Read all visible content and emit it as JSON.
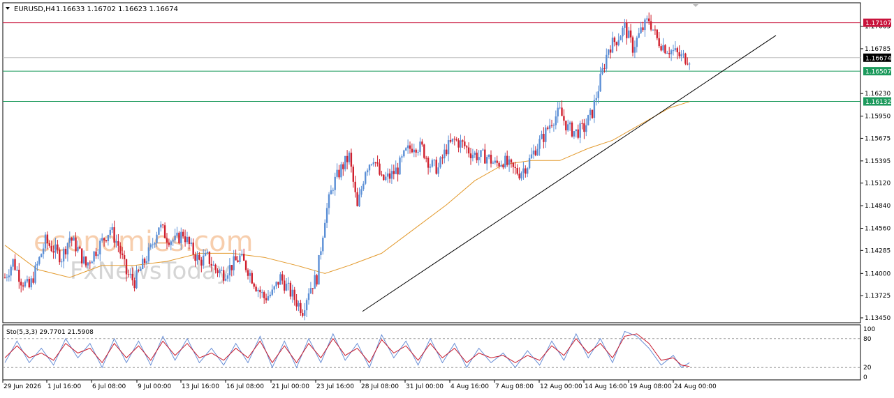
{
  "header": {
    "symbol": "EURUSD,H4",
    "ohlc": "1.16633 1.16702 1.16623 1.16674"
  },
  "watermark": {
    "line1": "economies.com",
    "line2": "FxNewsToday"
  },
  "chart_data": {
    "type": "candlestick",
    "symbol": "EURUSD",
    "timeframe": "H4",
    "ylim": [
      1.1345,
      1.1732
    ],
    "price_ticks": [
      "1.17065",
      "1.16785",
      "1.16230",
      "1.15950",
      "1.15675",
      "1.15395",
      "1.15120",
      "1.14840",
      "1.14560",
      "1.14285",
      "1.14000",
      "1.13725",
      "1.13450"
    ],
    "horizontal_levels": [
      {
        "value": 1.17107,
        "label": "1.17107",
        "color": "#c8143c",
        "kind": "resistance"
      },
      {
        "value": 1.16674,
        "label": "1.16674",
        "color": "#000000",
        "kind": "current-price"
      },
      {
        "value": 1.16507,
        "label": "1.16507",
        "color": "#1c9a5c",
        "kind": "support"
      },
      {
        "value": 1.16132,
        "label": "1.16132",
        "color": "#1c9a5c",
        "kind": "support"
      }
    ],
    "trendline": {
      "from": [
        0,
        1.1353
      ],
      "to": [
        145,
        1.1695
      ]
    },
    "time_labels": [
      "29 Jun 2026",
      "1 Jul 16:00",
      "6 Jul 08:00",
      "9 Jul 00:00",
      "13 Jul 16:00",
      "16 Jul 08:00",
      "21 Jul 00:00",
      "23 Jul 16:00",
      "28 Jul 08:00",
      "31 Jul 00:00",
      "4 Aug 16:00",
      "7 Aug 08:00",
      "12 Aug 00:00",
      "14 Aug 16:00",
      "19 Aug 08:00",
      "24 Aug 00:00"
    ],
    "price_path": [
      [
        0,
        1.1395
      ],
      [
        4,
        1.1415
      ],
      [
        8,
        1.1392
      ],
      [
        12,
        1.1382
      ],
      [
        16,
        1.141
      ],
      [
        20,
        1.144
      ],
      [
        24,
        1.143
      ],
      [
        28,
        1.142
      ],
      [
        32,
        1.1445
      ],
      [
        36,
        1.143
      ],
      [
        40,
        1.141
      ],
      [
        44,
        1.1425
      ],
      [
        48,
        1.144
      ],
      [
        52,
        1.1455
      ],
      [
        56,
        1.1435
      ],
      [
        60,
        1.14
      ],
      [
        64,
        1.139
      ],
      [
        68,
        1.141
      ],
      [
        72,
        1.143
      ],
      [
        76,
        1.146
      ],
      [
        80,
        1.1445
      ],
      [
        84,
        1.144
      ],
      [
        88,
        1.145
      ],
      [
        92,
        1.143
      ],
      [
        96,
        1.1415
      ],
      [
        100,
        1.142
      ],
      [
        104,
        1.1405
      ],
      [
        108,
        1.14
      ],
      [
        112,
        1.141
      ],
      [
        116,
        1.142
      ],
      [
        120,
        1.1405
      ],
      [
        124,
        1.1385
      ],
      [
        128,
        1.137
      ],
      [
        132,
        1.1375
      ],
      [
        136,
        1.1395
      ],
      [
        140,
        1.138
      ],
      [
        144,
        1.1365
      ],
      [
        147,
        1.1355
      ],
      [
        150,
        1.138
      ],
      [
        154,
        1.1395
      ],
      [
        158,
        1.147
      ],
      [
        162,
        1.151
      ],
      [
        166,
        1.153
      ],
      [
        170,
        1.1545
      ],
      [
        174,
        1.148
      ],
      [
        178,
        1.153
      ],
      [
        182,
        1.1545
      ],
      [
        186,
        1.1515
      ],
      [
        190,
        1.152
      ],
      [
        194,
        1.153
      ],
      [
        198,
        1.155
      ],
      [
        202,
        1.156
      ],
      [
        206,
        1.1555
      ],
      [
        210,
        1.1535
      ],
      [
        214,
        1.153
      ],
      [
        218,
        1.1555
      ],
      [
        222,
        1.1565
      ],
      [
        226,
        1.156
      ],
      [
        230,
        1.155
      ],
      [
        234,
        1.1545
      ],
      [
        238,
        1.1545
      ],
      [
        242,
        1.1535
      ],
      [
        246,
        1.154
      ],
      [
        250,
        1.153
      ],
      [
        254,
        1.1525
      ],
      [
        258,
        1.1535
      ],
      [
        262,
        1.1555
      ],
      [
        266,
        1.157
      ],
      [
        270,
        1.159
      ],
      [
        274,
        1.16
      ],
      [
        278,
        1.158
      ],
      [
        282,
        1.1575
      ],
      [
        286,
        1.158
      ],
      [
        290,
        1.16
      ],
      [
        294,
        1.164
      ],
      [
        298,
        1.168
      ],
      [
        302,
        1.169
      ],
      [
        306,
        1.1705
      ],
      [
        310,
        1.168
      ],
      [
        314,
        1.17
      ],
      [
        318,
        1.1715
      ],
      [
        322,
        1.169
      ],
      [
        326,
        1.168
      ],
      [
        330,
        1.1675
      ],
      [
        334,
        1.1668
      ],
      [
        338,
        1.1667
      ]
    ],
    "moving_average": [
      [
        0,
        1.1435
      ],
      [
        16,
        1.1405
      ],
      [
        32,
        1.1395
      ],
      [
        48,
        1.141
      ],
      [
        64,
        1.141
      ],
      [
        80,
        1.1415
      ],
      [
        96,
        1.1425
      ],
      [
        112,
        1.1425
      ],
      [
        128,
        1.142
      ],
      [
        144,
        1.141
      ],
      [
        158,
        1.14
      ],
      [
        170,
        1.141
      ],
      [
        186,
        1.1425
      ],
      [
        202,
        1.1455
      ],
      [
        218,
        1.1485
      ],
      [
        232,
        1.1515
      ],
      [
        246,
        1.1535
      ],
      [
        260,
        1.154
      ],
      [
        274,
        1.154
      ],
      [
        288,
        1.1555
      ],
      [
        300,
        1.1565
      ],
      [
        314,
        1.1585
      ],
      [
        328,
        1.1605
      ],
      [
        338,
        1.1613
      ]
    ],
    "stochastic": {
      "label": "Sto(5,3,3) 29.7701 21.5908",
      "ylim": [
        0,
        100
      ],
      "levels": [
        "20",
        "80"
      ],
      "scale_labels": [
        "100",
        "80",
        "20",
        "0"
      ],
      "main": [
        [
          0,
          30
        ],
        [
          6,
          75
        ],
        [
          12,
          30
        ],
        [
          18,
          60
        ],
        [
          24,
          25
        ],
        [
          30,
          80
        ],
        [
          36,
          40
        ],
        [
          42,
          70
        ],
        [
          48,
          20
        ],
        [
          54,
          80
        ],
        [
          60,
          30
        ],
        [
          66,
          75
        ],
        [
          72,
          25
        ],
        [
          78,
          85
        ],
        [
          84,
          35
        ],
        [
          90,
          80
        ],
        [
          96,
          30
        ],
        [
          102,
          60
        ],
        [
          108,
          25
        ],
        [
          114,
          70
        ],
        [
          120,
          30
        ],
        [
          126,
          85
        ],
        [
          132,
          20
        ],
        [
          138,
          75
        ],
        [
          144,
          20
        ],
        [
          150,
          80
        ],
        [
          156,
          30
        ],
        [
          162,
          90
        ],
        [
          168,
          35
        ],
        [
          174,
          70
        ],
        [
          180,
          20
        ],
        [
          186,
          88
        ],
        [
          192,
          40
        ],
        [
          198,
          75
        ],
        [
          204,
          25
        ],
        [
          210,
          80
        ],
        [
          216,
          30
        ],
        [
          222,
          70
        ],
        [
          228,
          20
        ],
        [
          234,
          60
        ],
        [
          240,
          30
        ],
        [
          246,
          50
        ],
        [
          252,
          20
        ],
        [
          258,
          55
        ],
        [
          264,
          25
        ],
        [
          270,
          75
        ],
        [
          276,
          35
        ],
        [
          282,
          90
        ],
        [
          288,
          40
        ],
        [
          294,
          80
        ],
        [
          300,
          30
        ],
        [
          306,
          95
        ],
        [
          312,
          85
        ],
        [
          318,
          60
        ],
        [
          324,
          25
        ],
        [
          330,
          45
        ],
        [
          334,
          20
        ],
        [
          338,
          30
        ]
      ],
      "signal": [
        [
          0,
          40
        ],
        [
          6,
          65
        ],
        [
          12,
          40
        ],
        [
          18,
          50
        ],
        [
          24,
          35
        ],
        [
          30,
          70
        ],
        [
          36,
          50
        ],
        [
          42,
          60
        ],
        [
          48,
          30
        ],
        [
          54,
          70
        ],
        [
          60,
          40
        ],
        [
          66,
          65
        ],
        [
          72,
          35
        ],
        [
          78,
          75
        ],
        [
          84,
          45
        ],
        [
          90,
          70
        ],
        [
          96,
          40
        ],
        [
          102,
          50
        ],
        [
          108,
          35
        ],
        [
          114,
          60
        ],
        [
          120,
          40
        ],
        [
          126,
          75
        ],
        [
          132,
          30
        ],
        [
          138,
          65
        ],
        [
          144,
          30
        ],
        [
          150,
          70
        ],
        [
          156,
          40
        ],
        [
          162,
          80
        ],
        [
          168,
          45
        ],
        [
          174,
          60
        ],
        [
          180,
          30
        ],
        [
          186,
          78
        ],
        [
          192,
          50
        ],
        [
          198,
          65
        ],
        [
          204,
          35
        ],
        [
          210,
          70
        ],
        [
          216,
          40
        ],
        [
          222,
          60
        ],
        [
          228,
          30
        ],
        [
          234,
          50
        ],
        [
          240,
          40
        ],
        [
          246,
          45
        ],
        [
          252,
          30
        ],
        [
          258,
          45
        ],
        [
          264,
          35
        ],
        [
          270,
          65
        ],
        [
          276,
          45
        ],
        [
          282,
          80
        ],
        [
          288,
          50
        ],
        [
          294,
          70
        ],
        [
          300,
          40
        ],
        [
          306,
          85
        ],
        [
          312,
          90
        ],
        [
          318,
          70
        ],
        [
          324,
          35
        ],
        [
          330,
          40
        ],
        [
          334,
          25
        ],
        [
          338,
          22
        ]
      ]
    }
  }
}
